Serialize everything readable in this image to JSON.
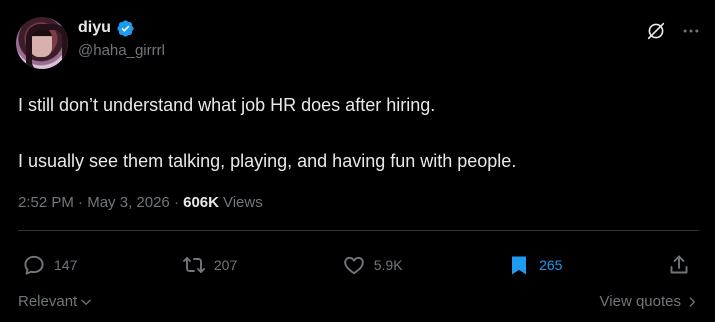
{
  "author": {
    "display_name": "diyu",
    "handle": "@haha_girrrl",
    "verified_icon": "verified-badge-icon",
    "verified_color": "#1d9bf0"
  },
  "tweet": {
    "lines": [
      "I still don’t understand what job HR does after hiring.",
      "I usually see them talking, playing, and having fun with people."
    ],
    "time": "2:52 PM",
    "separator": " · ",
    "date": "May 3, 2026",
    "separator2": " · ",
    "views_count": "606K",
    "views_label": "Views"
  },
  "actions": {
    "replies": "147",
    "reposts": "207",
    "likes": "5.9K",
    "bookmarks": "265",
    "bookmark_color": "#1d9bf0"
  },
  "footer": {
    "sort_label": "Relevant",
    "view_quotes_label": "View quotes"
  },
  "icons": [
    "grok-icon",
    "more-icon",
    "reply-icon",
    "repost-icon",
    "like-icon",
    "bookmark-icon",
    "share-icon",
    "chevron-down-icon",
    "chevron-right-icon"
  ]
}
